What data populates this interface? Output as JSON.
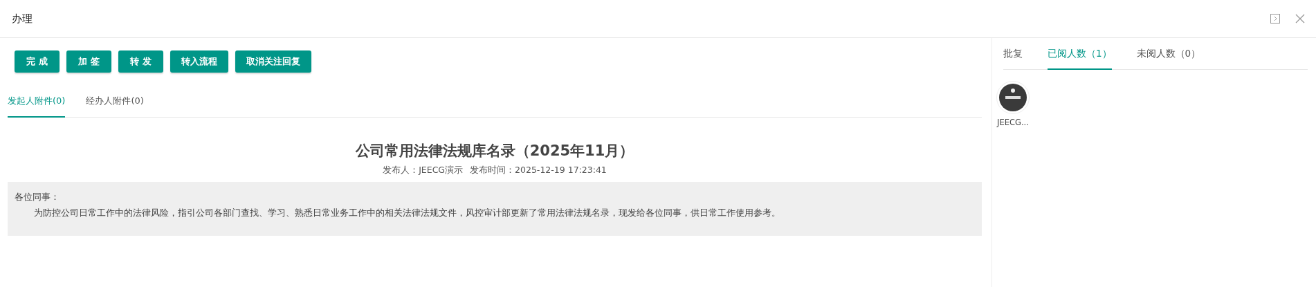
{
  "window": {
    "title": "办理"
  },
  "actions": [
    "完 成",
    "加 签",
    "转 发",
    "转入流程",
    "取消关注回复"
  ],
  "attachment_tabs": [
    {
      "label": "发起人附件(0)",
      "selected": true
    },
    {
      "label": "经办人附件(0)",
      "selected": false
    }
  ],
  "notice": {
    "title": "公司常用法律法规库名录（2025年11月）",
    "publisher": "发布人：JEECG演示",
    "published_at": "发布时间：2025-12-19 17:23:41",
    "greeting": "各位同事：",
    "body": "为防控公司日常工作中的法律风险，指引公司各部门查找、学习、熟悉日常业务工作中的相关法律法规文件，风控审计部更新了常用法律法规名录，现发给各位同事，供日常工作使用参考。"
  },
  "side_tabs": [
    {
      "label": "批复",
      "selected": false
    },
    {
      "label": "已阅人数（1）",
      "selected": true
    },
    {
      "label": "未阅人数（0）",
      "selected": false
    }
  ],
  "readers": [
    {
      "name": "JEECG..."
    }
  ]
}
